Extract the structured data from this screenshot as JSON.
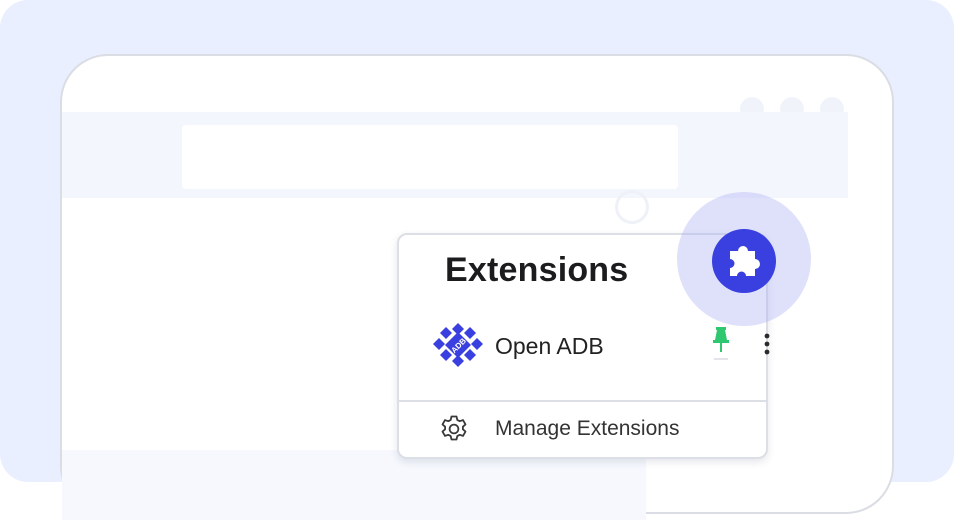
{
  "popup": {
    "title": "Extensions",
    "extension": {
      "name": "Open ADB",
      "logo_text": "ADB",
      "logo_color": "#3a3fe0",
      "pin_icon": "pin-icon",
      "pin_color": "#2fc76f",
      "menu_icon": "more-vert-icon"
    },
    "manage": {
      "icon": "gear-icon",
      "label": "Manage Extensions"
    }
  },
  "toolbar": {
    "extensions_button_icon": "puzzle-piece-icon",
    "accent_color": "#3a3fe0"
  }
}
